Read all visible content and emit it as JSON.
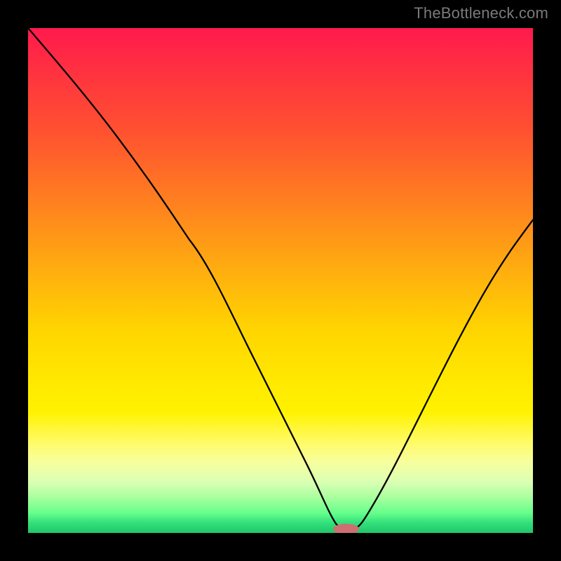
{
  "watermark": "TheBottleneck.com",
  "chart_data": {
    "type": "line",
    "title": "",
    "xlabel": "",
    "ylabel": "",
    "xlim": [
      0,
      100
    ],
    "ylim": [
      0,
      100
    ],
    "x": [
      0,
      8,
      16,
      24,
      32,
      38,
      44,
      50,
      56,
      58,
      62,
      64,
      66,
      70,
      74,
      80,
      86,
      92,
      100
    ],
    "values": [
      100,
      92,
      84,
      75,
      65,
      52,
      40,
      28,
      15,
      10,
      3,
      1,
      1,
      4,
      10,
      21,
      34,
      46,
      60
    ],
    "gradient_stops": [
      {
        "pos": 0.0,
        "hex": "#ff1a4d"
      },
      {
        "pos": 0.25,
        "hex": "#ff6a27"
      },
      {
        "pos": 0.5,
        "hex": "#ffbb0a"
      },
      {
        "pos": 0.7,
        "hex": "#ffe500"
      },
      {
        "pos": 0.85,
        "hex": "#fffb66"
      },
      {
        "pos": 0.95,
        "hex": "#66ff8c"
      },
      {
        "pos": 1.0,
        "hex": "#1fc76a"
      }
    ],
    "marker": {
      "x": 63,
      "y": 0.8,
      "rx": 2.6,
      "ry": 1.0,
      "hex": "#cf6f72"
    },
    "note": "x and values are in percent of the plot area; (0,100)=top-left, (100,0)=bottom-right."
  }
}
